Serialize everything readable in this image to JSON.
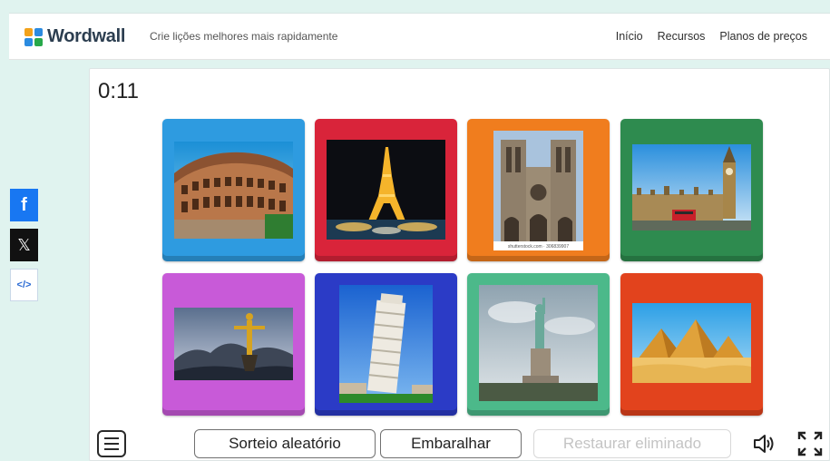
{
  "header": {
    "brand": "Wordwall",
    "tagline": "Crie lições melhores mais rapidamente",
    "nav": [
      "Início",
      "Recursos",
      "Planos de preços"
    ]
  },
  "share": {
    "facebook_glyph": "f",
    "x_glyph": "𝕏",
    "embed_glyph": "</>"
  },
  "game": {
    "timer": "0:11",
    "photo_caption": "shutterstock.com · 306839907",
    "cards": [
      {
        "subject": "colosseum",
        "color": "#2e9be0"
      },
      {
        "subject": "eiffel-tower",
        "color": "#d9243a"
      },
      {
        "subject": "notre-dame",
        "color": "#f07d1e"
      },
      {
        "subject": "big-ben",
        "color": "#2e8b4f"
      },
      {
        "subject": "christ-the-redeemer",
        "color": "#c85ad8"
      },
      {
        "subject": "leaning-tower-of-pisa",
        "color": "#2b3bc6"
      },
      {
        "subject": "statue-of-liberty",
        "color": "#4cb98a"
      },
      {
        "subject": "pyramids-of-giza",
        "color": "#e2431d"
      }
    ]
  },
  "toolbar": {
    "random_draw": "Sorteio aleatório",
    "shuffle": "Embaralhar",
    "restore_removed": "Restaurar eliminado"
  },
  "icons": {
    "menu": "menu-icon",
    "sound": "speaker-icon",
    "fullscreen": "fullscreen-icon"
  }
}
